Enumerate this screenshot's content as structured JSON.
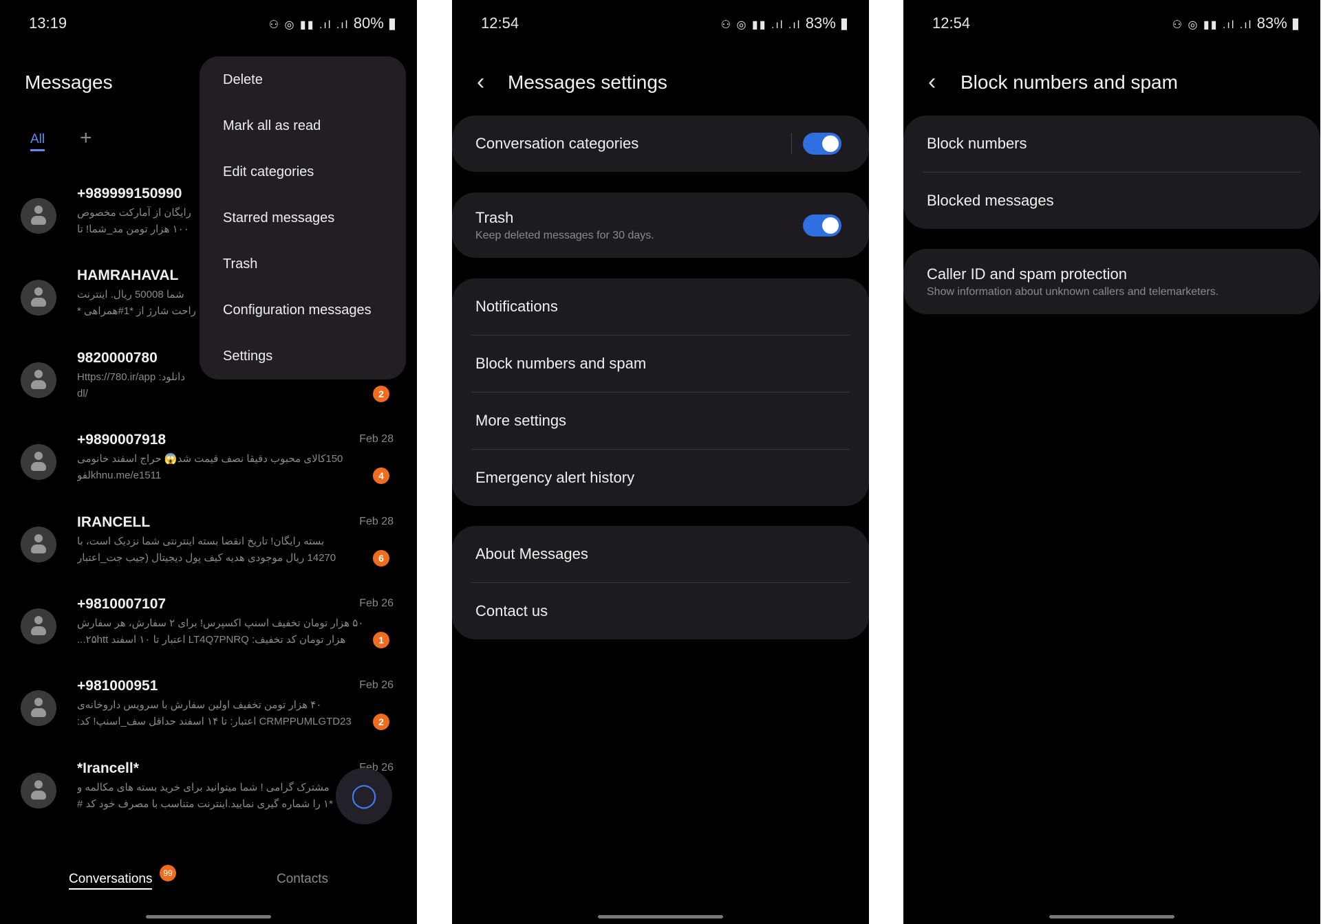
{
  "screen1": {
    "status": {
      "time": "13:19",
      "battery": "80%"
    },
    "title": "Messages",
    "tabs": {
      "all": "All",
      "add": "+"
    },
    "menu": [
      "Delete",
      "Mark all as read",
      "Edit categories",
      "Starred messages",
      "Trash",
      "Configuration messages",
      "Settings"
    ],
    "conversations": [
      {
        "name": "+989999150990",
        "date": "",
        "preview1": "رایگان از آمارکت مخصوص",
        "preview2": "۱۰۰ هزار تومن مد_شما! تا",
        "badge": ""
      },
      {
        "name": "HAMRAHAVAL",
        "date": "",
        "preview1": "شما 50008 ریال. اینترنت",
        "preview2": "راحت شارژ از *1#همراهی *",
        "badge": ""
      },
      {
        "name": "9820000780",
        "date": "",
        "preview1": "دانلود: Https://780.ir/app",
        "preview2": "/dl",
        "badge": "2"
      },
      {
        "name": "+9890007918",
        "date": "Feb 28",
        "preview1": "150کالای محبوب دقیقا نصف قیمت شد😱 حراج اسفند خانومی",
        "preview2": "khnu.me/e1511لفو",
        "badge": "4"
      },
      {
        "name": "IRANCELL",
        "date": "Feb 28",
        "preview1": "بسته رایگان! تاریخ انقضا بسته اینترنتی شما نزدیک است، با",
        "preview2": "14270 ریال موجودی هدیه کیف پول دیجیتال (جیب جت_اعتبار",
        "badge": "6"
      },
      {
        "name": "+9810007107",
        "date": "Feb 26",
        "preview1": "۵۰ هزار تومان تخفیف اسنپ اکسپرس! برای ۲ سفارش، هر سفارش",
        "preview2": "هزار تومان کد تخفیف: LT4Q7PNRQ اعتبار تا ۱۰ اسفند ۲۵htt...",
        "badge": "1"
      },
      {
        "name": "+981000951",
        "date": "Feb 26",
        "preview1": "۴۰ هزار تومن تخفیف اولین سفارش با سرویس داروخانه‌ی",
        "preview2": "CRMPPUMLGTD23 اعتبار: تا ۱۴ اسفند حداقل سف_اسنپ! کد:",
        "badge": "2"
      },
      {
        "name": "*Irancell*",
        "date": "Feb 26",
        "preview1": "مشترک گرامی ! شما میتوانید برای خرید بسته های مکالمه و",
        "preview2": "*۱ را شماره گیری نمایید.اینترنت متناسب با مصرف خود کد #",
        "badge": ""
      }
    ],
    "bottom_nav": {
      "conversations": "Conversations",
      "badge": "99",
      "contacts": "Contacts"
    }
  },
  "screen2": {
    "status": {
      "time": "12:54",
      "battery": "83%"
    },
    "title": "Messages settings",
    "conversation_categories": {
      "label": "Conversation categories",
      "on": true
    },
    "trash": {
      "label": "Trash",
      "sub": "Keep deleted messages for 30 days.",
      "on": true
    },
    "group3": [
      "Notifications",
      "Block numbers and spam",
      "More settings",
      "Emergency alert history"
    ],
    "group4": [
      "About Messages",
      "Contact us"
    ]
  },
  "screen3": {
    "status": {
      "time": "12:54",
      "battery": "83%"
    },
    "title": "Block numbers and spam",
    "group1": [
      "Block numbers",
      "Blocked messages"
    ],
    "caller_id": {
      "label": "Caller ID and spam protection",
      "sub": "Show information about unknown callers and telemarketers."
    }
  },
  "colors": {
    "accent": "#2f6fe0",
    "badge": "#f06c1f",
    "card": "#1e1b20"
  }
}
